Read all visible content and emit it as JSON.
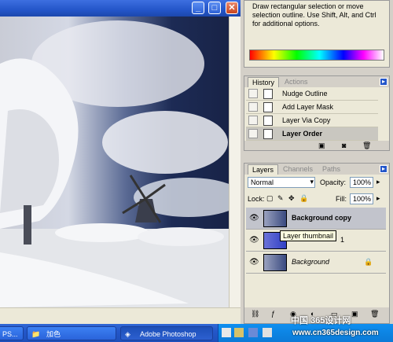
{
  "document": {
    "window_buttons": {
      "minimize": "_",
      "maximize": "□",
      "close": "✕"
    }
  },
  "navigator": {
    "hint_text": "Draw rectangular selection or move selection outline.  Use Shift, Alt, and Ctrl for additional options."
  },
  "history": {
    "tabs": [
      "History",
      "Actions"
    ],
    "items": [
      {
        "label": "Nudge Outline"
      },
      {
        "label": "Add Layer Mask"
      },
      {
        "label": "Layer Via Copy"
      },
      {
        "label": "Layer Order"
      }
    ]
  },
  "layers": {
    "tabs": [
      "Layers",
      "Channels",
      "Paths"
    ],
    "blend_mode": "Normal",
    "opacity_label": "Opacity:",
    "opacity_value": "100%",
    "lock_label": "Lock:",
    "fill_label": "Fill:",
    "fill_value": "100%",
    "items": [
      {
        "name": "Background copy"
      },
      {
        "name": "1"
      },
      {
        "name": "Background"
      }
    ],
    "tooltip": "Layer thumbnail"
  },
  "taskbar": {
    "items": [
      {
        "label": "PS..."
      },
      {
        "label": "加色"
      },
      {
        "label": "Adobe Photoshop"
      }
    ]
  },
  "watermark": {
    "line1": "中国 365设计网",
    "line2": "www.cn365design.com"
  }
}
